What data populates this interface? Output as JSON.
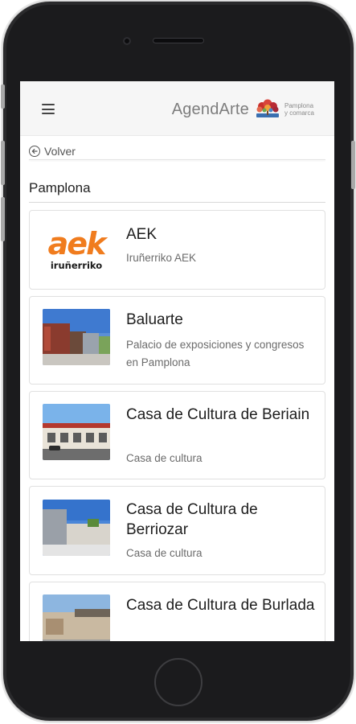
{
  "header": {
    "brand": "AgendArte",
    "brand_sub_line1": "Pamplona",
    "brand_sub_line2": "y comarca",
    "menu_icon": "hamburger-menu-icon"
  },
  "nav": {
    "back_label": "Volver",
    "back_icon": "arrow-left-circle-icon"
  },
  "section": {
    "title": "Pamplona"
  },
  "venues": [
    {
      "title": "AEK",
      "subtitle": "Iruñerriko AEK",
      "logo_text": "aek",
      "logo_sub": "iruñerriko"
    },
    {
      "title": "Baluarte",
      "subtitle": "Palacio de exposiciones y congresos en Pamplona"
    },
    {
      "title": "Casa de Cultura de Beriain",
      "subtitle": "Casa de cultura"
    },
    {
      "title": "Casa de Cultura de Berriozar",
      "subtitle": "Casa de cultura"
    },
    {
      "title": "Casa de Cultura de Burlada",
      "subtitle": ""
    }
  ],
  "colors": {
    "aek_orange": "#f07c1e",
    "topbar_bg": "#f6f6f6",
    "title_text": "#1e1e1e",
    "subtitle_text": "#6b6b6b"
  }
}
